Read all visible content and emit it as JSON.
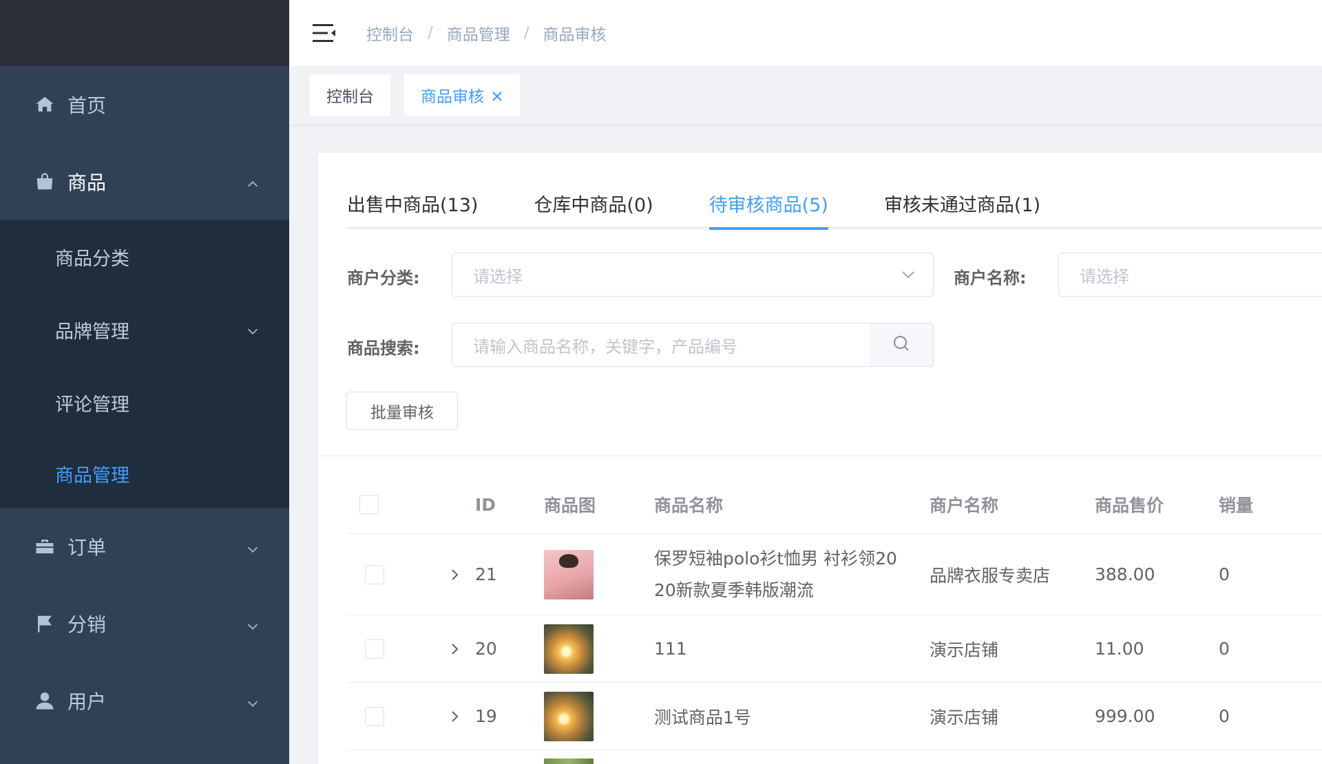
{
  "breadcrumb": [
    "控制台",
    "商品管理",
    "商品审核"
  ],
  "breadcrumb_sep": "/",
  "tags": [
    {
      "label": "控制台"
    },
    {
      "label": "商品审核"
    }
  ],
  "sidebar": {
    "items": [
      {
        "label": "首页",
        "icon": "home-icon"
      },
      {
        "label": "商品",
        "icon": "shopping-bag-icon"
      },
      {
        "label": "订单",
        "icon": "briefcase-icon"
      },
      {
        "label": "分销",
        "icon": "flag-icon"
      },
      {
        "label": "用户",
        "icon": "user-icon"
      }
    ],
    "submenu": [
      {
        "label": "商品分类"
      },
      {
        "label": "品牌管理"
      },
      {
        "label": "评论管理"
      },
      {
        "label": "商品管理"
      }
    ],
    "active_color": "#409eff"
  },
  "tabs": [
    {
      "label": "出售中商品(13)"
    },
    {
      "label": "仓库中商品(0)"
    },
    {
      "label": "待审核商品(5)"
    },
    {
      "label": "审核未通过商品(1)"
    }
  ],
  "filters": {
    "merchant_category_label": "商户分类:",
    "merchant_category_placeholder": "请选择",
    "merchant_name_label": "商户名称:",
    "merchant_name_placeholder": "请选择",
    "search_label": "商品搜索:",
    "search_placeholder": "请输入商品名称，关键字，产品编号"
  },
  "batch_button": "批量审核",
  "table": {
    "columns": [
      "ID",
      "商品图",
      "商品名称",
      "商户名称",
      "商品售价",
      "销量"
    ],
    "rows": [
      {
        "id": "21",
        "name_line1": "保罗短袖polo衫t恤男 衬衫领20",
        "name_line2": "20新款夏季韩版潮流",
        "merchant": "品牌衣服专卖店",
        "price": "388.00",
        "sales": "0"
      },
      {
        "id": "20",
        "name_line1": "111",
        "name_line2": "",
        "merchant": "演示店铺",
        "price": "11.00",
        "sales": "0"
      },
      {
        "id": "19",
        "name_line1": "测试商品1号",
        "name_line2": "",
        "merchant": "演示店铺",
        "price": "999.00",
        "sales": "0"
      }
    ]
  }
}
